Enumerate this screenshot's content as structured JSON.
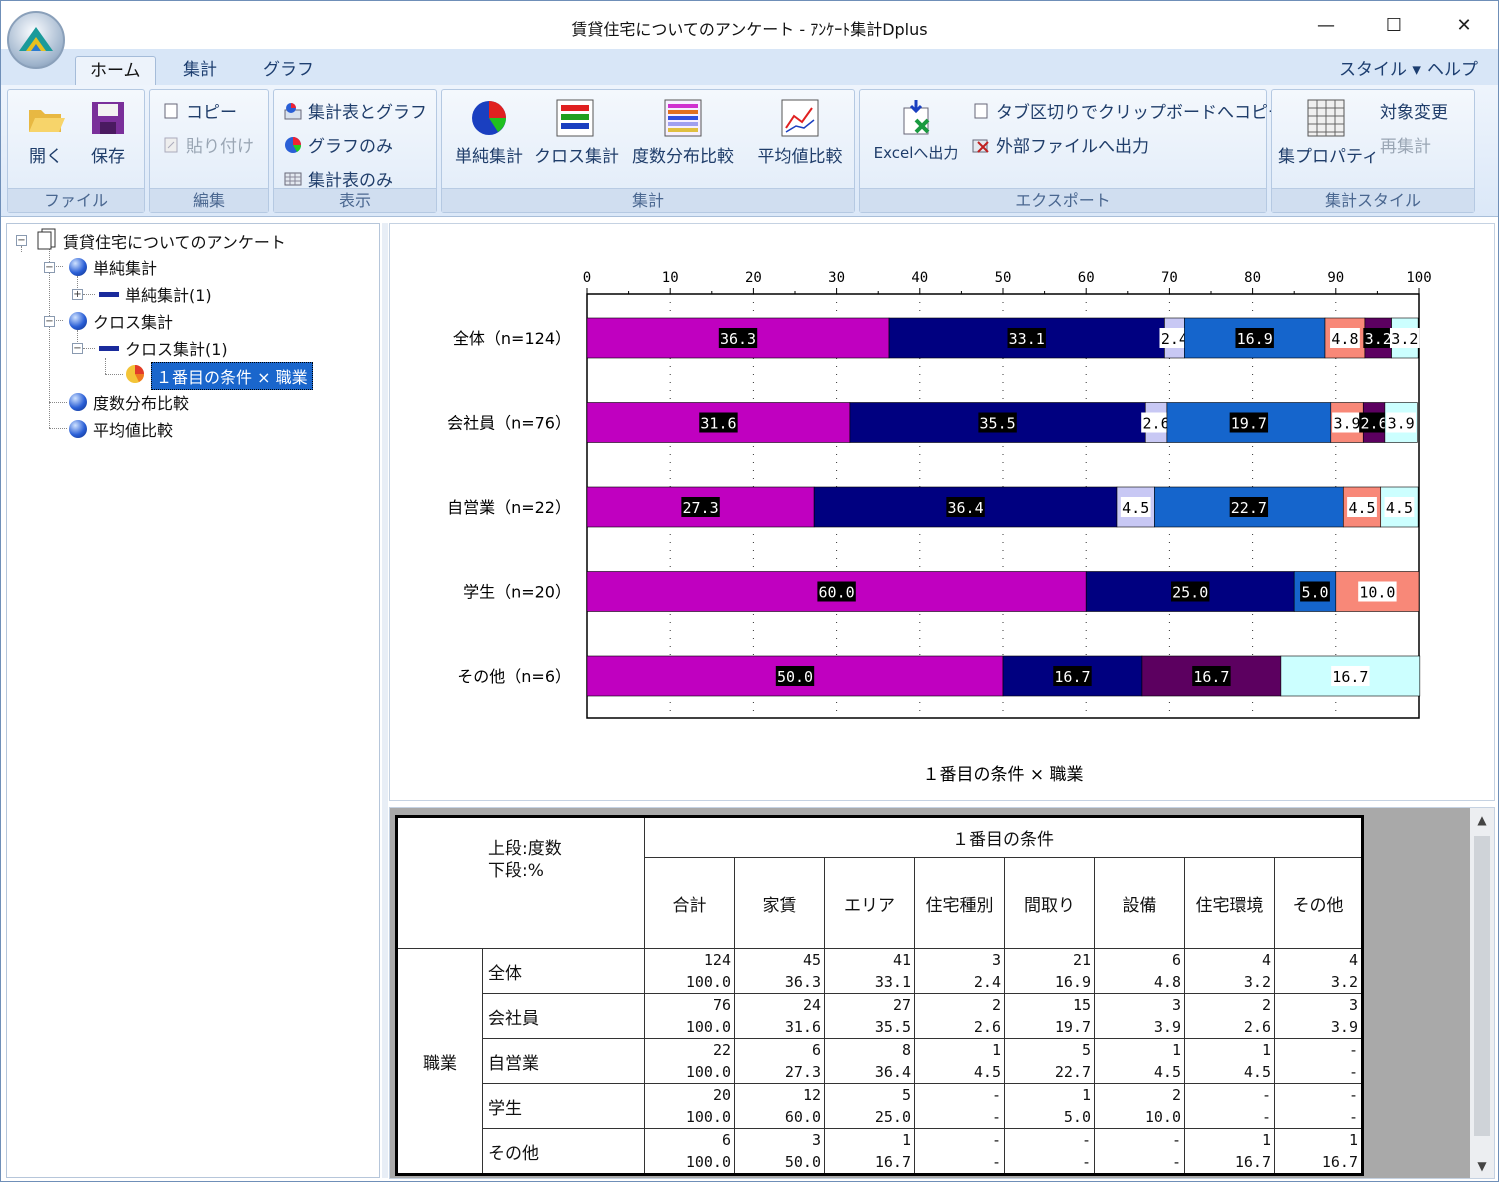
{
  "window": {
    "title": "賃貸住宅についてのアンケート - ｱﾝｹｰﾄ集計Dplus",
    "minimize": "—",
    "maximize": "☐",
    "close": "✕"
  },
  "tabs": [
    {
      "label": "ホーム"
    },
    {
      "label": "集計"
    },
    {
      "label": "グラフ"
    }
  ],
  "right_menu": {
    "style": "スタイル",
    "help": "ヘルプ",
    "arrow": "▾"
  },
  "ribbon": {
    "file": {
      "label": "ファイル",
      "open": "開く",
      "save": "保存"
    },
    "edit": {
      "label": "編集",
      "copy": "コピー",
      "paste": "貼り付け"
    },
    "view": {
      "label": "表示",
      "table_graph": "集計表とグラフ",
      "graph_only": "グラフのみ",
      "table_only": "集計表のみ"
    },
    "agg": {
      "label": "集計",
      "simple": "単純集計",
      "cross": "クロス集計",
      "freq": "度数分布比較",
      "mean": "平均値比較"
    },
    "export": {
      "label": "エクスポート",
      "excel": "Excelへ出力",
      "tab_copy": "タブ区切りでクリップボードへコピー",
      "ext": "外部ファイルへ出力"
    },
    "style": {
      "label": "集計スタイル",
      "props": "集プロパティ",
      "target": "対象変更",
      "reagg": "再集計"
    }
  },
  "tree": {
    "root": "賃貸住宅についてのアンケート",
    "simple": "単純集計",
    "simple1": "単純集計(1)",
    "cross": "クロス集計",
    "cross1": "クロス集計(1)",
    "selected": "１番目の条件 × 職業",
    "freq": "度数分布比較",
    "mean": "平均値比較",
    "plus": "+",
    "minus": "−"
  },
  "chart_data": {
    "type": "bar",
    "orientation": "horizontal-stacked-100",
    "title": "１番目の条件 × 職業",
    "xlim": [
      0,
      100
    ],
    "xticks": [
      0,
      10,
      20,
      30,
      40,
      50,
      60,
      70,
      80,
      90,
      100
    ],
    "categories": [
      "全体（n=124）",
      "会社員（n=76）",
      "自営業（n=22）",
      "学生（n=20）",
      "その他（n=6）"
    ],
    "series": [
      {
        "values": [
          36.3,
          31.6,
          27.3,
          60.0,
          50.0
        ],
        "color": "#c000c0",
        "label_color": "#ffffff"
      },
      {
        "values": [
          33.1,
          35.5,
          36.4,
          25.0,
          16.7
        ],
        "color": "#000080",
        "label_color": "#ffffff"
      },
      {
        "values": [
          2.4,
          2.6,
          4.5,
          0,
          0
        ],
        "color": "#c8c8f4",
        "label_color": "#000000"
      },
      {
        "values": [
          16.9,
          19.7,
          22.7,
          5.0,
          0
        ],
        "color": "#1565cc",
        "label_color": "#ffffff"
      },
      {
        "values": [
          4.8,
          3.9,
          4.5,
          10.0,
          0
        ],
        "color": "#f88878",
        "label_color": "#000000"
      },
      {
        "values": [
          3.2,
          2.6,
          0,
          0,
          16.7
        ],
        "color": "#5c0060",
        "label_color": "#ffffff"
      },
      {
        "values": [
          3.2,
          3.9,
          4.5,
          0,
          16.7
        ],
        "color": "#ccffff",
        "label_color": "#000000"
      }
    ],
    "labels": [
      [
        "36.3",
        "33.1",
        "2.4",
        "16.9",
        "4.8",
        "3.2",
        "3.2"
      ],
      [
        "31.6",
        "35.5",
        "2.6",
        "19.7",
        "3.9",
        "2.6",
        "3.9"
      ],
      [
        "27.3",
        "36.4",
        "4.5",
        "22.7",
        "4.5",
        "",
        "4.5"
      ],
      [
        "60.0",
        "25.0",
        "",
        "5.0",
        "10.0",
        "",
        ""
      ],
      [
        "50.0",
        "16.7",
        "",
        "",
        "",
        "16.7",
        "16.7"
      ]
    ]
  },
  "table": {
    "corner": [
      "上段:度数",
      "下段:%"
    ],
    "group_header": "１番目の条件",
    "columns": [
      "合計",
      "家賃",
      "エリア",
      "住宅種別",
      "間取り",
      "設備",
      "住宅環境",
      "その他"
    ],
    "row_group": "職業",
    "rows": [
      {
        "label": "全体",
        "counts": [
          "124",
          "45",
          "41",
          "3",
          "21",
          "6",
          "4",
          "4"
        ],
        "pcts": [
          "100.0",
          "36.3",
          "33.1",
          "2.4",
          "16.9",
          "4.8",
          "3.2",
          "3.2"
        ]
      },
      {
        "label": "会社員",
        "counts": [
          "76",
          "24",
          "27",
          "2",
          "15",
          "3",
          "2",
          "3"
        ],
        "pcts": [
          "100.0",
          "31.6",
          "35.5",
          "2.6",
          "19.7",
          "3.9",
          "2.6",
          "3.9"
        ]
      },
      {
        "label": "自営業",
        "counts": [
          "22",
          "6",
          "8",
          "1",
          "5",
          "1",
          "1",
          "-"
        ],
        "pcts": [
          "100.0",
          "27.3",
          "36.4",
          "4.5",
          "22.7",
          "4.5",
          "4.5",
          "-"
        ]
      },
      {
        "label": "学生",
        "counts": [
          "20",
          "12",
          "5",
          "-",
          "1",
          "2",
          "-",
          "-"
        ],
        "pcts": [
          "100.0",
          "60.0",
          "25.0",
          "-",
          "5.0",
          "10.0",
          "-",
          "-"
        ]
      },
      {
        "label": "その他",
        "counts": [
          "6",
          "3",
          "1",
          "-",
          "-",
          "-",
          "1",
          "1"
        ],
        "pcts": [
          "100.0",
          "50.0",
          "16.7",
          "-",
          "-",
          "-",
          "16.7",
          "16.7"
        ]
      }
    ]
  },
  "scroll": {
    "up": "▲",
    "down": "▼"
  }
}
